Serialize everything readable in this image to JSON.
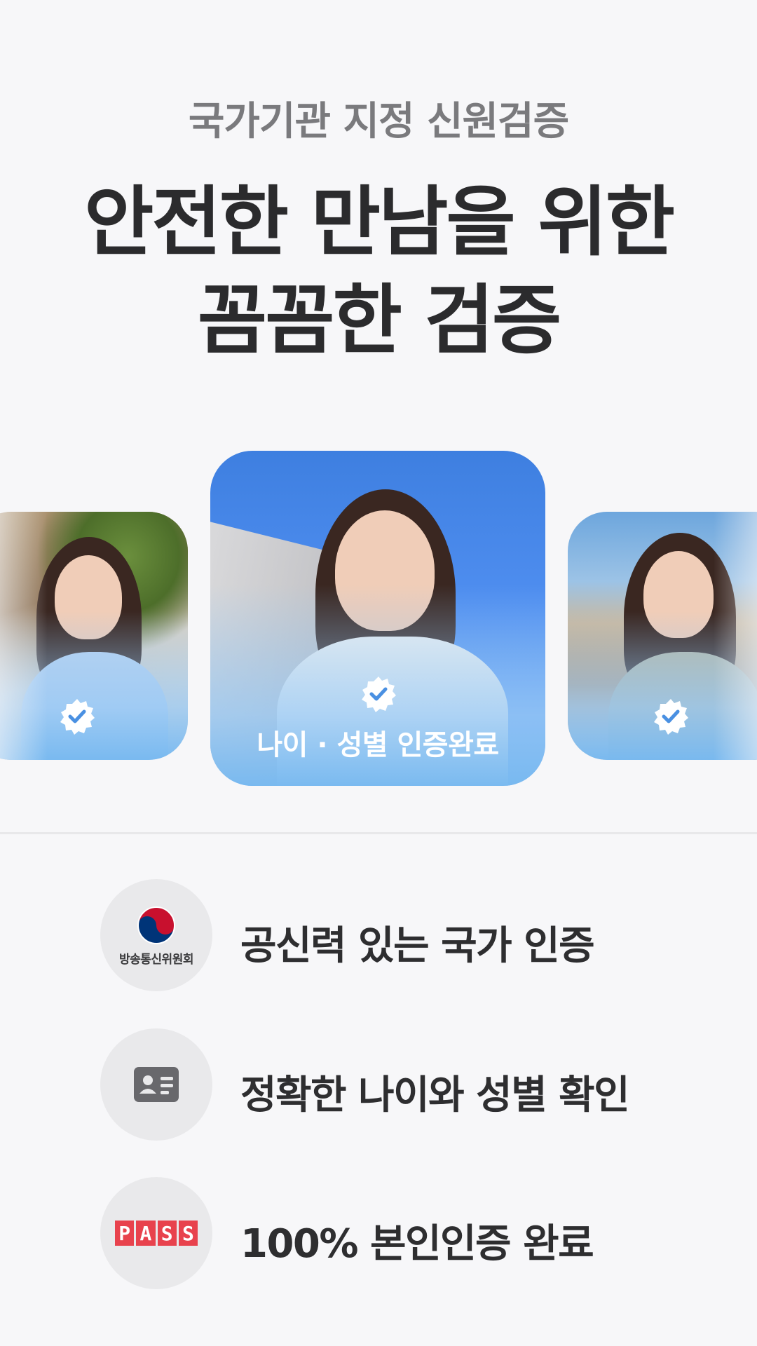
{
  "header": {
    "subtitle": "국가기관 지정 신원검증",
    "headline_line1": "안전한 만남을 위한",
    "headline_line2": "꼼꼼한 검증"
  },
  "carousel": {
    "center_label": "나이 · 성별 인증완료",
    "badge_icon": "verified-check-icon"
  },
  "features": [
    {
      "icon": "kcc-logo-icon",
      "icon_text": "방송통신위원회",
      "label": "공신력 있는 국가 인증"
    },
    {
      "icon": "id-card-icon",
      "label": "정확한 나이와 성별 확인"
    },
    {
      "icon": "pass-logo-icon",
      "icon_text": [
        "P",
        "A",
        "S",
        "S"
      ],
      "label": "100% 본인인증 완료"
    }
  ],
  "colors": {
    "background": "#f7f7f9",
    "headline": "#2b2b2d",
    "subtitle": "#7a7a7d",
    "card_sky": "#4f8ef0",
    "pass_red": "#e8424d",
    "kcc_red": "#c8102e",
    "kcc_blue": "#003478"
  }
}
